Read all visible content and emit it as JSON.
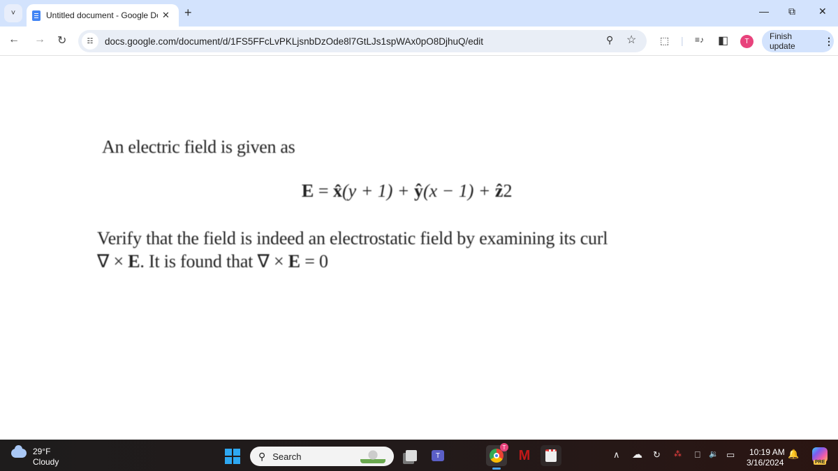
{
  "browser": {
    "tab_title": "Untitled document - Google Do",
    "url": "docs.google.com/document/d/1FS5FFcLvPKLjsnbDzOde8l7GtLJs1spWAx0pO8DjhuQ/edit",
    "profile_initial": "T",
    "finish_update_label": "Finish update",
    "accent_color": "#d3e3fd",
    "icons": {
      "tab_search": "˅",
      "tab_close": "✕",
      "new_tab": "+",
      "minimize": "—",
      "restore": "⧉",
      "close": "✕",
      "back": "←",
      "forward": "→",
      "reload": "↻",
      "site_info": "☷",
      "zoom": "⚲",
      "bookmark": "☆",
      "extensions": "⬚",
      "media": "≡♪",
      "side_panel": "◧",
      "menu": "⋮"
    }
  },
  "document": {
    "paragraph1": "An electric field is given as",
    "equation": {
      "lhs": "E",
      "eq": " = ",
      "x_hat": "x̂",
      "x_term": "(y + 1) + ",
      "y_hat": "ŷ",
      "y_term": "(x − 1) + ",
      "z_hat": "ẑ",
      "z_term": "2"
    },
    "paragraph2_line1": "Verify that the field is indeed an electrostatic field by examining its curl",
    "paragraph2_line2": {
      "nabla1": "∇ × ",
      "E1": "E",
      "mid": ". It is found that ∇ × ",
      "E2": "E",
      "end": " = 0"
    }
  },
  "taskbar": {
    "weather_temp": "29°F",
    "weather_condition": "Cloudy",
    "search_label": "Search",
    "search_icon": "⚲",
    "time": "10:19 AM",
    "date": "3/16/2024",
    "chrome_badge": "T",
    "tray_icons": {
      "chevron": "∧",
      "onedrive": "☁",
      "sync": "↻",
      "network": "⎕",
      "volume": "🔉",
      "battery": "▭",
      "bell": "🔔"
    },
    "copilot_badge": "PRE"
  }
}
